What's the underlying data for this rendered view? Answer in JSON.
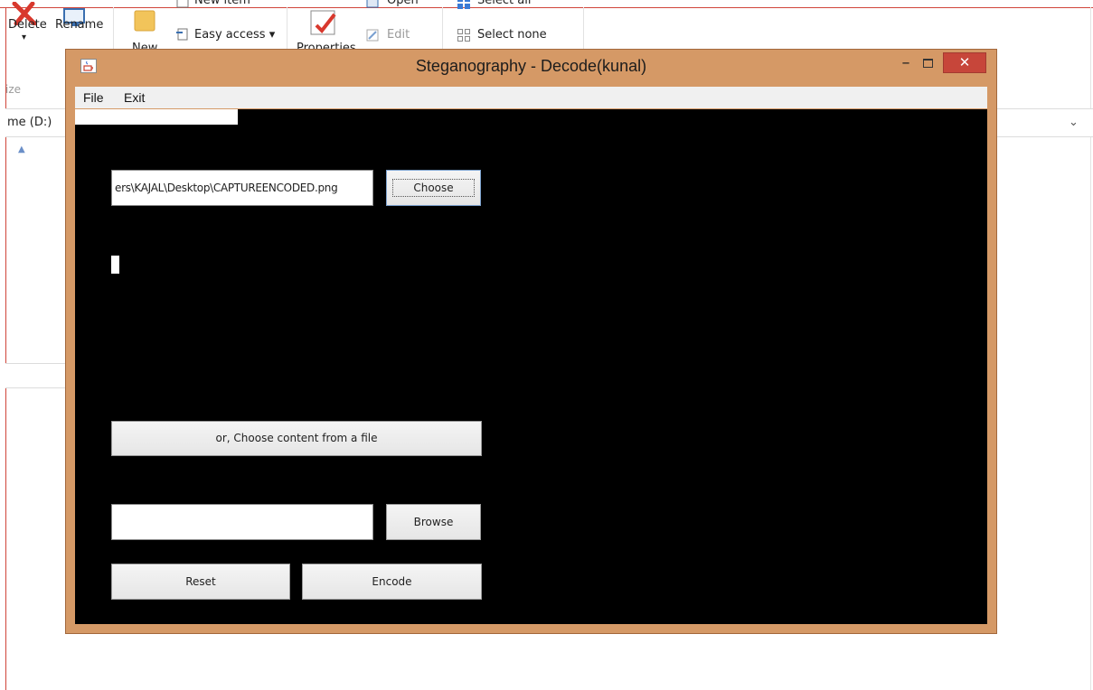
{
  "explorer": {
    "ribbon": {
      "delete_label": "Delete",
      "delete_arrow": "▾",
      "rename_label": "Rename",
      "new_label": "New",
      "new_item_label": "New item",
      "easy_access_label": "Easy access ▾",
      "properties_label": "Properties",
      "open_label": "Open",
      "edit_label": "Edit",
      "select_all_label": "Select all",
      "select_none_label": "Select none",
      "group_label": "ize"
    },
    "address": "me (D:)",
    "address_chevron": "⌄"
  },
  "window": {
    "title": "Steganography - Decode(kunal)",
    "icon": "java-cup-icon",
    "minimize_glyph": "–",
    "close_glyph": "✕",
    "accent_color": "#d59966",
    "close_color": "#c7463a"
  },
  "menu": {
    "file": "File",
    "exit": "Exit"
  },
  "form": {
    "file_path": "ers\\KAJAL\\Desktop\\CAPTUREENCODED.png",
    "choose_label": "Choose",
    "content_file_label": "or, Choose content from a file",
    "browse_value": "",
    "browse_label": "Browse",
    "reset_label": "Reset",
    "encode_label": "Encode"
  }
}
